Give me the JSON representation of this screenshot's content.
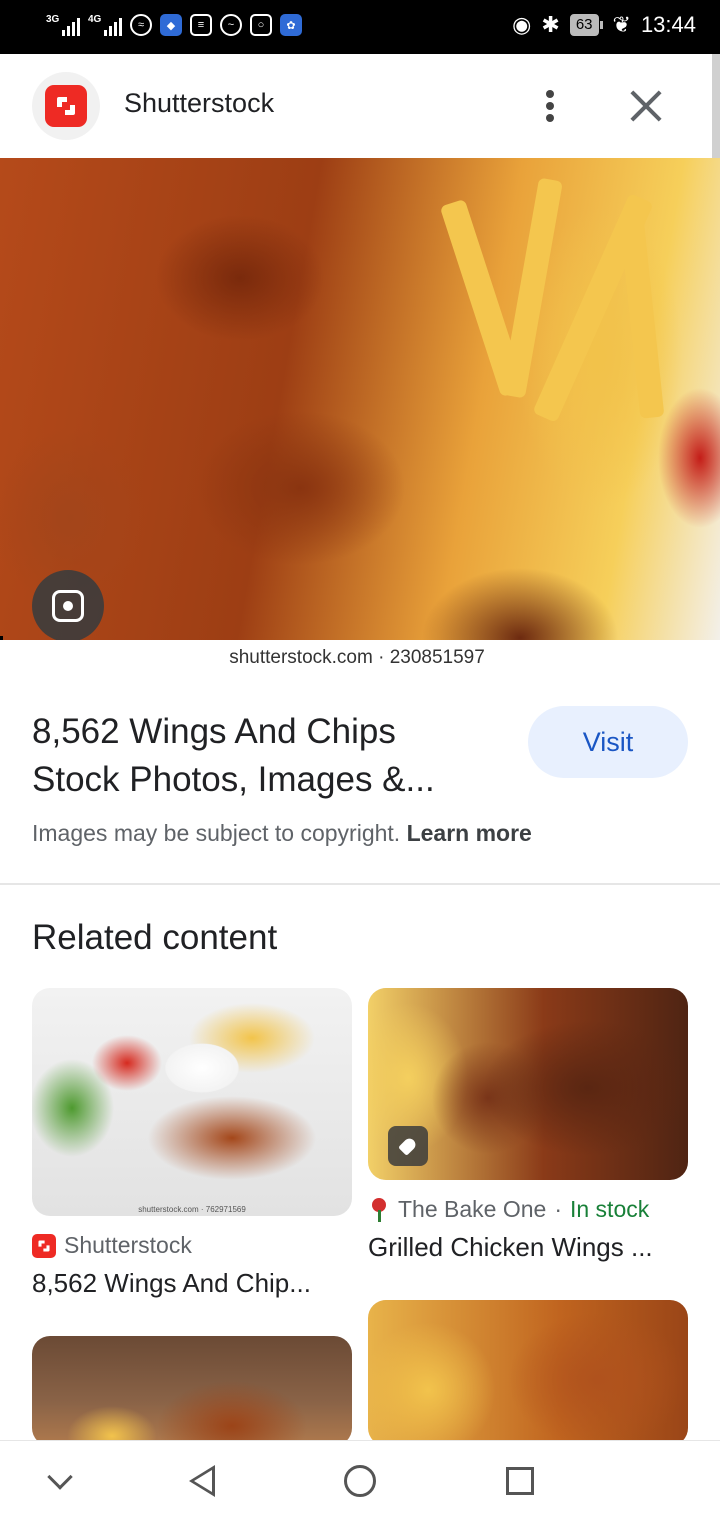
{
  "status_bar": {
    "network_1": "3G",
    "network_2": "4G",
    "battery": "63",
    "time": "13:44"
  },
  "header": {
    "site_name": "Shutterstock",
    "logo_icon": "shutterstock-logo",
    "more_icon": "more-vert-icon",
    "close_icon": "close-icon"
  },
  "hero": {
    "caption": "shutterstock.com · 230851597",
    "lens_icon": "lens-search-icon"
  },
  "result": {
    "title": "8,562 Wings And Chips Stock Photos, Images &...",
    "visit_label": "Visit",
    "copyright_text": "Images may be subject to copyright.",
    "learn_more": "Learn more"
  },
  "related": {
    "heading": "Related content",
    "items": [
      {
        "watermark": "shutterstock.com · 762971569",
        "source": "Shutterstock",
        "caption": "8,562 Wings And Chip..."
      },
      {
        "source": "The Bake One",
        "separator": "·",
        "availability": "In stock",
        "caption": "Grilled Chicken Wings ..."
      }
    ]
  },
  "colors": {
    "accent": "#1a56c4",
    "visit_bg": "#e8f0fe",
    "brand": "#ee2a24",
    "in_stock": "#188038"
  },
  "nav": {
    "icons": [
      "chevron-down-icon",
      "back-icon",
      "home-icon",
      "recents-icon"
    ]
  }
}
